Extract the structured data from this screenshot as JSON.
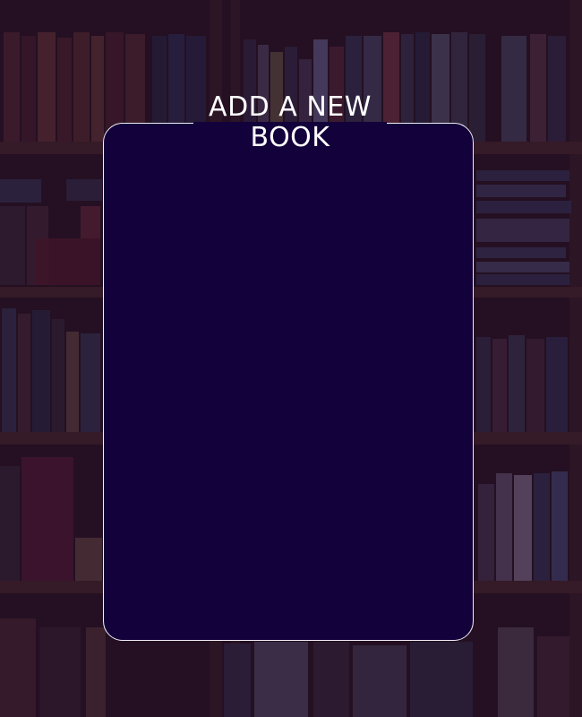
{
  "form": {
    "title": "ADD A NEW BOOK"
  },
  "colors": {
    "card_background": "#12013a",
    "card_border": "#f2eef7",
    "title_text": "#ffffff",
    "overlay_tint": "#1c0830"
  },
  "background": {
    "image_subject": "bookshelf"
  }
}
